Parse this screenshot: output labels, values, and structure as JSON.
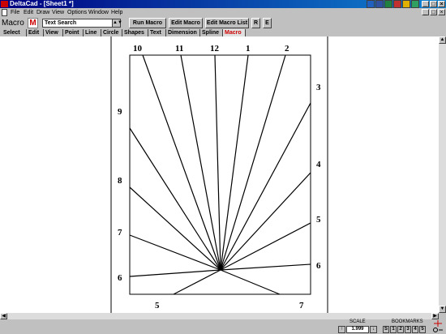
{
  "window": {
    "title": "DeltaCad - [Sheet1 *]"
  },
  "title_buttons": [
    "_",
    "□",
    "×"
  ],
  "doc_buttons": [
    "_",
    "□",
    "×"
  ],
  "menu": [
    "File",
    "Edit",
    "Draw",
    "View",
    "Options",
    "Window",
    "Help"
  ],
  "toolbar": {
    "label": "Macro",
    "macro_icon": "M",
    "combo_value": "Text Search",
    "combo_arrow": "▲▼",
    "run": "Run Macro",
    "edit": "Edit Macro",
    "edit_list": "Edit Macro List",
    "r": "R",
    "e": "E"
  },
  "tabs": [
    "Select",
    "Edit",
    "View",
    "Point",
    "Line",
    "Circle",
    "Shapes",
    "Text",
    "Dimension",
    "Spline",
    "Macro"
  ],
  "active_tab": "Macro",
  "drawing": {
    "hour_labels": [
      "10",
      "11",
      "12",
      "1",
      "2",
      "3",
      "9",
      "4",
      "8",
      "5",
      "7",
      "6",
      "6",
      "5",
      "7"
    ]
  },
  "status": {
    "scale_label": "SCALE",
    "bookmarks_label": "BOOKMARKS",
    "scale_up": "↑",
    "scale_value": "1.999",
    "scale_down": "↓",
    "bookmarks": [
      "S",
      "1",
      "2",
      "3",
      "4",
      "5"
    ]
  },
  "colors": {
    "title_start": "#000080",
    "title_end": "#1084d0",
    "accent": "#cc0000"
  }
}
